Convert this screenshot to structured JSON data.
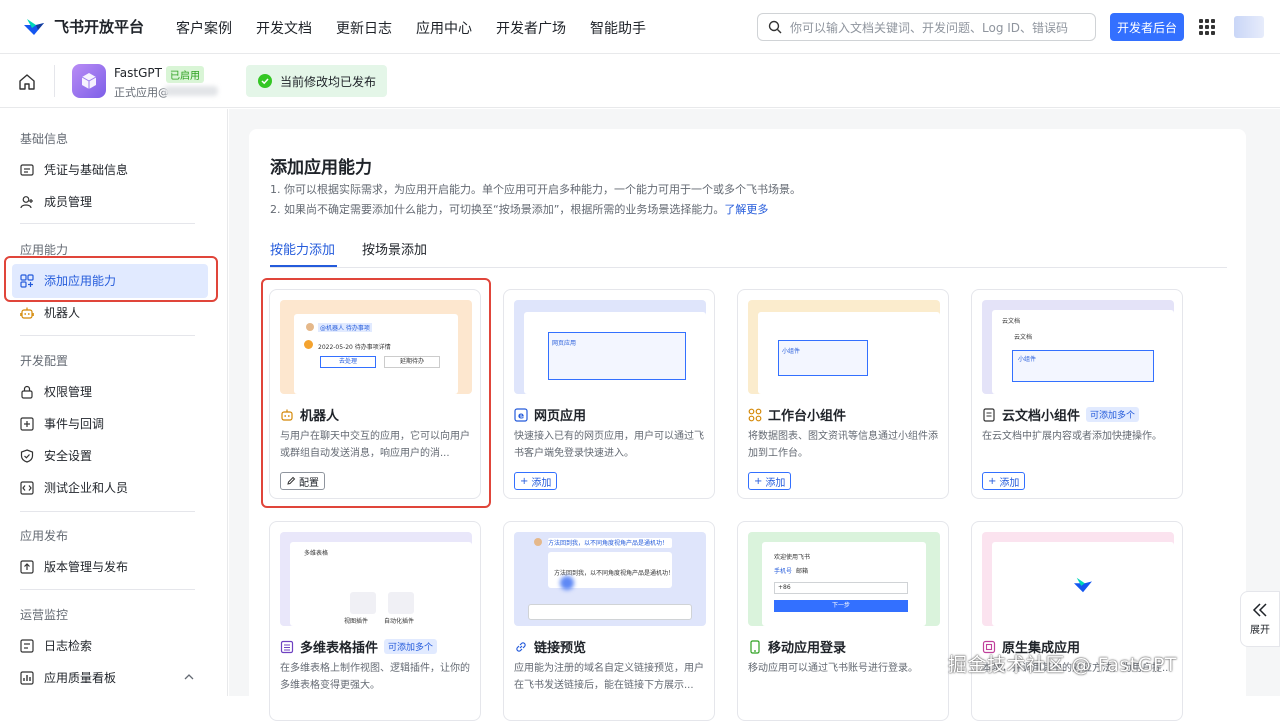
{
  "topnav": {
    "brand": "飞书开放平台",
    "links": [
      "客户案例",
      "开发文档",
      "更新日志",
      "应用中心",
      "开发者广场",
      "智能助手"
    ],
    "search_placeholder": "你可以输入文档关键词、开发问题、Log ID、错误码",
    "dev_console": "开发者后台"
  },
  "app": {
    "name": "FastGPT",
    "status": "已启用",
    "type": "正式应用@",
    "publish_notice": "当前修改均已发布"
  },
  "sidebar": {
    "groups": [
      {
        "title": "基础信息",
        "items": [
          {
            "label": "凭证与基础信息",
            "icon": "id-card-icon"
          },
          {
            "label": "成员管理",
            "icon": "user-add-icon"
          }
        ]
      },
      {
        "title": "应用能力",
        "items": [
          {
            "label": "添加应用能力",
            "icon": "grid-add-icon",
            "active": true
          },
          {
            "label": "机器人",
            "icon": "robot-icon"
          }
        ]
      },
      {
        "title": "开发配置",
        "items": [
          {
            "label": "权限管理",
            "icon": "lock-icon"
          },
          {
            "label": "事件与回调",
            "icon": "event-icon"
          },
          {
            "label": "安全设置",
            "icon": "shield-icon"
          },
          {
            "label": "测试企业和人员",
            "icon": "test-icon"
          }
        ]
      },
      {
        "title": "应用发布",
        "items": [
          {
            "label": "版本管理与发布",
            "icon": "upload-icon"
          }
        ]
      },
      {
        "title": "运营监控",
        "items": [
          {
            "label": "日志检索",
            "icon": "log-icon"
          },
          {
            "label": "应用质量看板",
            "icon": "dashboard-icon"
          }
        ]
      }
    ]
  },
  "main": {
    "title": "添加应用能力",
    "desc1": "1. 你可以根据实际需求，为应用开启能力。单个应用可开启多种能力，一个能力可用于一个或多个飞书场景。",
    "desc2": "2. 如果尚不确定需要添加什么能力，可切换至“按场景添加”，根据所需的业务场景选择能力。",
    "learn_more": "了解更多",
    "tabs": [
      "按能力添加",
      "按场景添加"
    ],
    "cards": [
      {
        "title": "机器人",
        "icon": "robot-icon",
        "tag": "",
        "desc": "与用户在聊天中交互的应用，它可以向用户或群组自动发送消息，响应用户的消...",
        "button": "配置",
        "preview_color": "#fde7cf"
      },
      {
        "title": "网页应用",
        "icon": "web-icon",
        "tag": "",
        "desc": "快速接入已有的网页应用，用户可以通过飞书客户端免登录快速进入。",
        "button": "添加",
        "preview_color": "#dfe5fb"
      },
      {
        "title": "工作台小组件",
        "icon": "widget-icon",
        "tag": "",
        "desc": "将数据图表、图文资讯等信息通过小组件添加到工作台。",
        "button": "添加",
        "preview_color": "#fbeccd"
      },
      {
        "title": "云文档小组件",
        "icon": "doc-icon",
        "tag": "可添加多个",
        "desc": "在云文档中扩展内容或者添加快捷操作。",
        "button": "添加",
        "preview_color": "#e4e3f8"
      },
      {
        "title": "多维表格插件",
        "icon": "table-icon",
        "tag": "可添加多个",
        "desc": "在多维表格上制作视图、逻辑插件，让你的多维表格变得更强大。",
        "button": "",
        "preview_color": "#e9e7fa"
      },
      {
        "title": "链接预览",
        "icon": "link-icon",
        "tag": "",
        "desc": "应用能为注册的域名自定义链接预览，用户在飞书发送链接后，能在链接下方展示...",
        "button": "",
        "preview_color": "#dfe5fb"
      },
      {
        "title": "移动应用登录",
        "icon": "mobile-icon",
        "tag": "",
        "desc": "移动应用可以通过飞书账号进行登录。",
        "button": "",
        "preview_color": "#daf3dc"
      },
      {
        "title": "原生集成应用",
        "icon": "native-icon",
        "tag": "",
        "desc": "本地，并调用其中的对应方法，为用户提...",
        "button": "",
        "preview_color": "#fbe3ef"
      }
    ],
    "card_previews": {
      "bot_row1": "@机器人 待办事项",
      "bot_row2": "2022-05-20 待办事项详情",
      "bot_btn1": "去处理",
      "bot_btn2": "延期待办",
      "web_label": "网页应用",
      "widget_label": "小组件",
      "doc_header": "云文档",
      "doc_sub": "云文档",
      "doc_label": "小组件",
      "table_header": "多维表格",
      "table_btn1": "视图插件",
      "table_btn2": "自动化插件",
      "link_banner": "方法回到我，以不同角度视角产品是通机功！",
      "link_reply": "方法回到我，以不同角度视角产品是通机功！",
      "login_title": "欢迎使用飞书",
      "login_tab1": "手机号",
      "login_tab2": "邮箱",
      "login_code": "+86",
      "login_btn": "下一步"
    }
  },
  "expand_label": "展开",
  "watermark": "掘金技术社区 @ FastGPT"
}
